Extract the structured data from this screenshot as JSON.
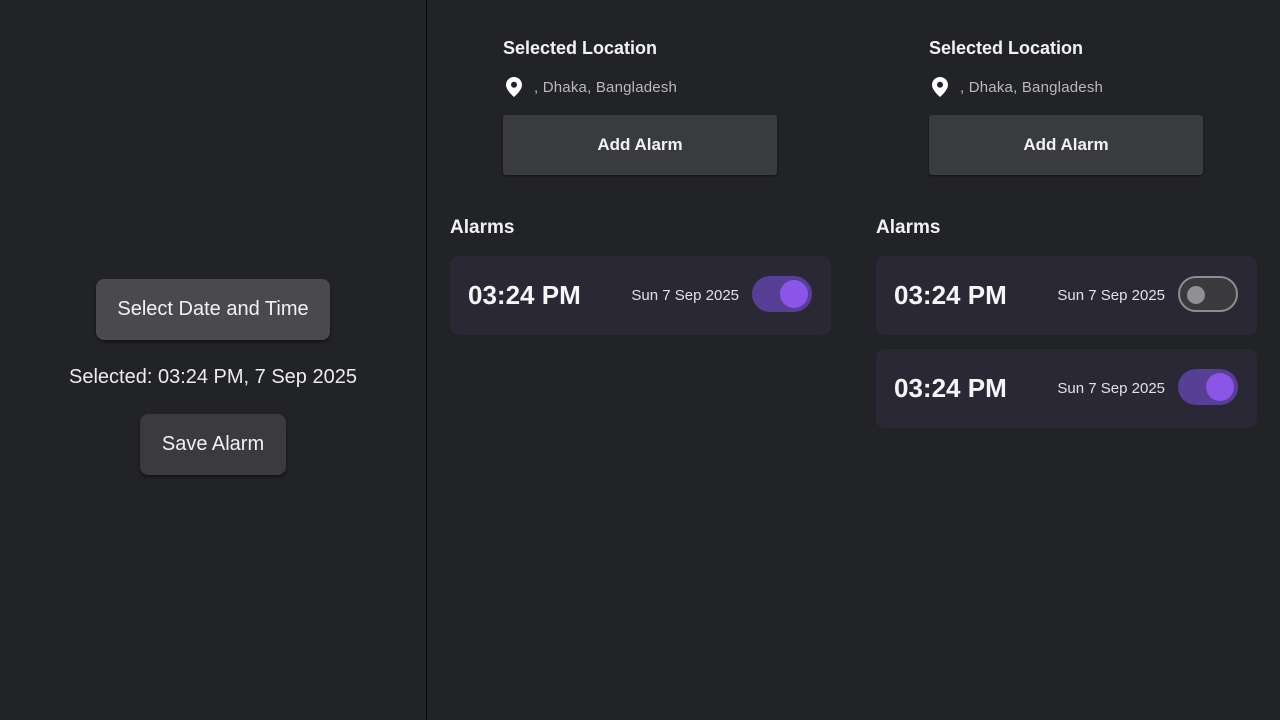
{
  "left": {
    "select_button_label": "Select Date and Time",
    "selected_text": "Selected: 03:24 PM, 7 Sep 2025",
    "save_button_label": "Save Alarm"
  },
  "panels": [
    {
      "location_title": "Selected Location",
      "location_text": ", Dhaka, Bangladesh",
      "add_button_label": "Add Alarm",
      "alarms_title": "Alarms",
      "alarms": [
        {
          "time": "03:24 PM",
          "date": "Sun 7 Sep 2025",
          "enabled": true
        }
      ]
    },
    {
      "location_title": "Selected Location",
      "location_text": ", Dhaka, Bangladesh",
      "add_button_label": "Add Alarm",
      "alarms_title": "Alarms",
      "alarms": [
        {
          "time": "03:24 PM",
          "date": "Sun 7 Sep 2025",
          "enabled": false
        },
        {
          "time": "03:24 PM",
          "date": "Sun 7 Sep 2025",
          "enabled": true
        }
      ]
    }
  ],
  "icons": {
    "location": "location-pin-icon"
  },
  "colors": {
    "background": "#222327",
    "accent": "#8B55E8",
    "card": "#2A2834",
    "toggle_track_on": "#573F96"
  }
}
